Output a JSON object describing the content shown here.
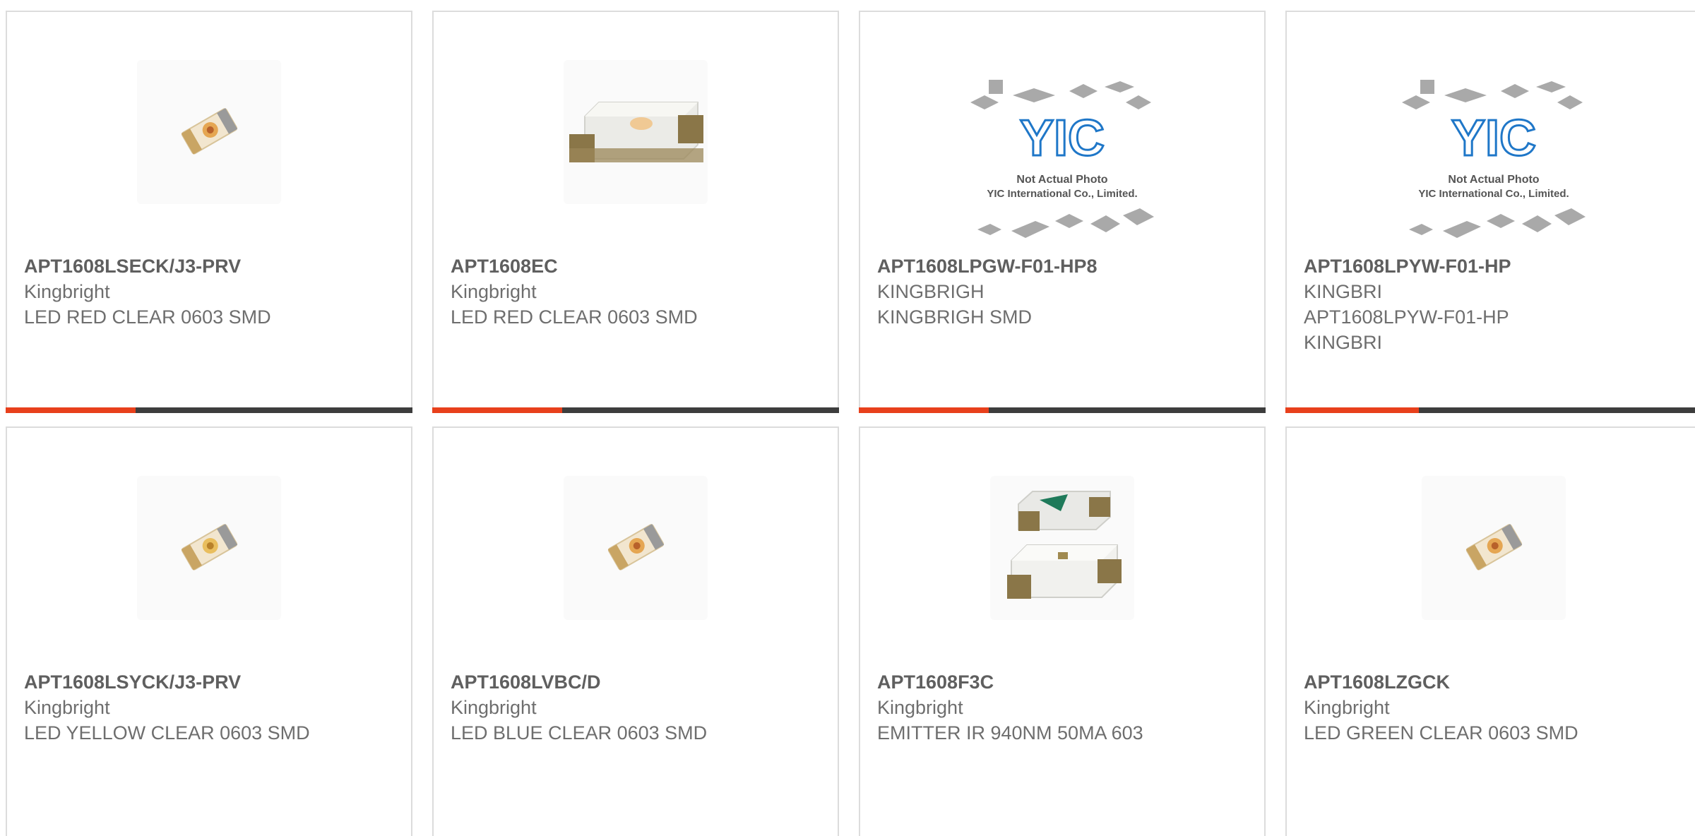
{
  "colors": {
    "accent": "#e8401c",
    "bar_track": "#3d3d3d",
    "card_border": "#dcdcdc",
    "text": "#666666",
    "logo_blue": "#1f77c8"
  },
  "placeholder": {
    "logo_text": "YIC",
    "note_line1": "Not Actual Photo",
    "note_line2": "YIC International Co., Limited."
  },
  "products": [
    {
      "part_number": "APT1608LSECK/J3-PRV",
      "manufacturer": "Kingbright",
      "description": "LED RED CLEAR 0603 SMD",
      "image": "led-smd-photo",
      "bar_fraction": 0.32
    },
    {
      "part_number": "APT1608EC",
      "manufacturer": "Kingbright",
      "description": "LED RED CLEAR 0603 SMD",
      "image": "led-smd-large-photo",
      "bar_fraction": 0.32
    },
    {
      "part_number": "APT1608LPGW-F01-HP8",
      "manufacturer": "KINGBRIGH",
      "description": "KINGBRIGH SMD",
      "image": "not-actual-photo",
      "bar_fraction": 0.32
    },
    {
      "part_number": "APT1608LPYW-F01-HP",
      "manufacturer": "KINGBRI",
      "description": "APT1608LPYW-F01-HP KINGBRI",
      "image": "not-actual-photo",
      "bar_fraction": 0.32
    },
    {
      "part_number": "APT1608LSYCK/J3-PRV",
      "manufacturer": "Kingbright",
      "description": "LED YELLOW CLEAR 0603 SMD",
      "image": "led-smd-photo"
    },
    {
      "part_number": "APT1608LVBC/D",
      "manufacturer": "Kingbright",
      "description": "LED BLUE CLEAR 0603 SMD",
      "image": "led-smd-photo"
    },
    {
      "part_number": "APT1608F3C",
      "manufacturer": "Kingbright",
      "description": "EMITTER IR 940NM 50MA 603",
      "image": "ir-emitter-photo"
    },
    {
      "part_number": "APT1608LZGCK",
      "manufacturer": "Kingbright",
      "description": "LED GREEN CLEAR 0603 SMD",
      "image": "led-smd-photo"
    }
  ]
}
